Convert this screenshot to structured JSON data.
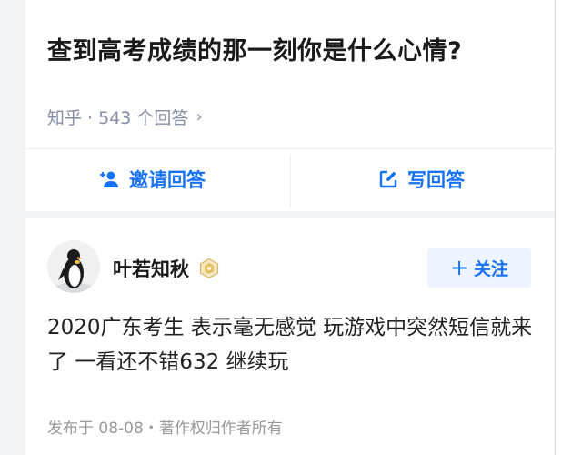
{
  "question": {
    "title": "查到高考成绩的那一刻你是什么心情?",
    "meta": "知乎 · 543 个回答",
    "chevron_icon": "chevron-right-icon"
  },
  "actions": {
    "invite_label": "邀请回答",
    "invite_icon": "add-user-icon",
    "write_label": "写回答",
    "write_icon": "edit-icon"
  },
  "answer": {
    "author": "叶若知秋",
    "badge_icon": "hexagon-badge-icon",
    "avatar_icon": "penguin-avatar",
    "follow_label": "关注",
    "text": "2020广东考生 表示毫无感觉 玩游戏中突然短信就来了 一看还不错632 继续玩",
    "meta": "发布于 08-08・著作权归作者所有"
  },
  "colors": {
    "accent": "#1772f6",
    "muted": "#8590a6",
    "follow_bg": "#eef4ff"
  }
}
